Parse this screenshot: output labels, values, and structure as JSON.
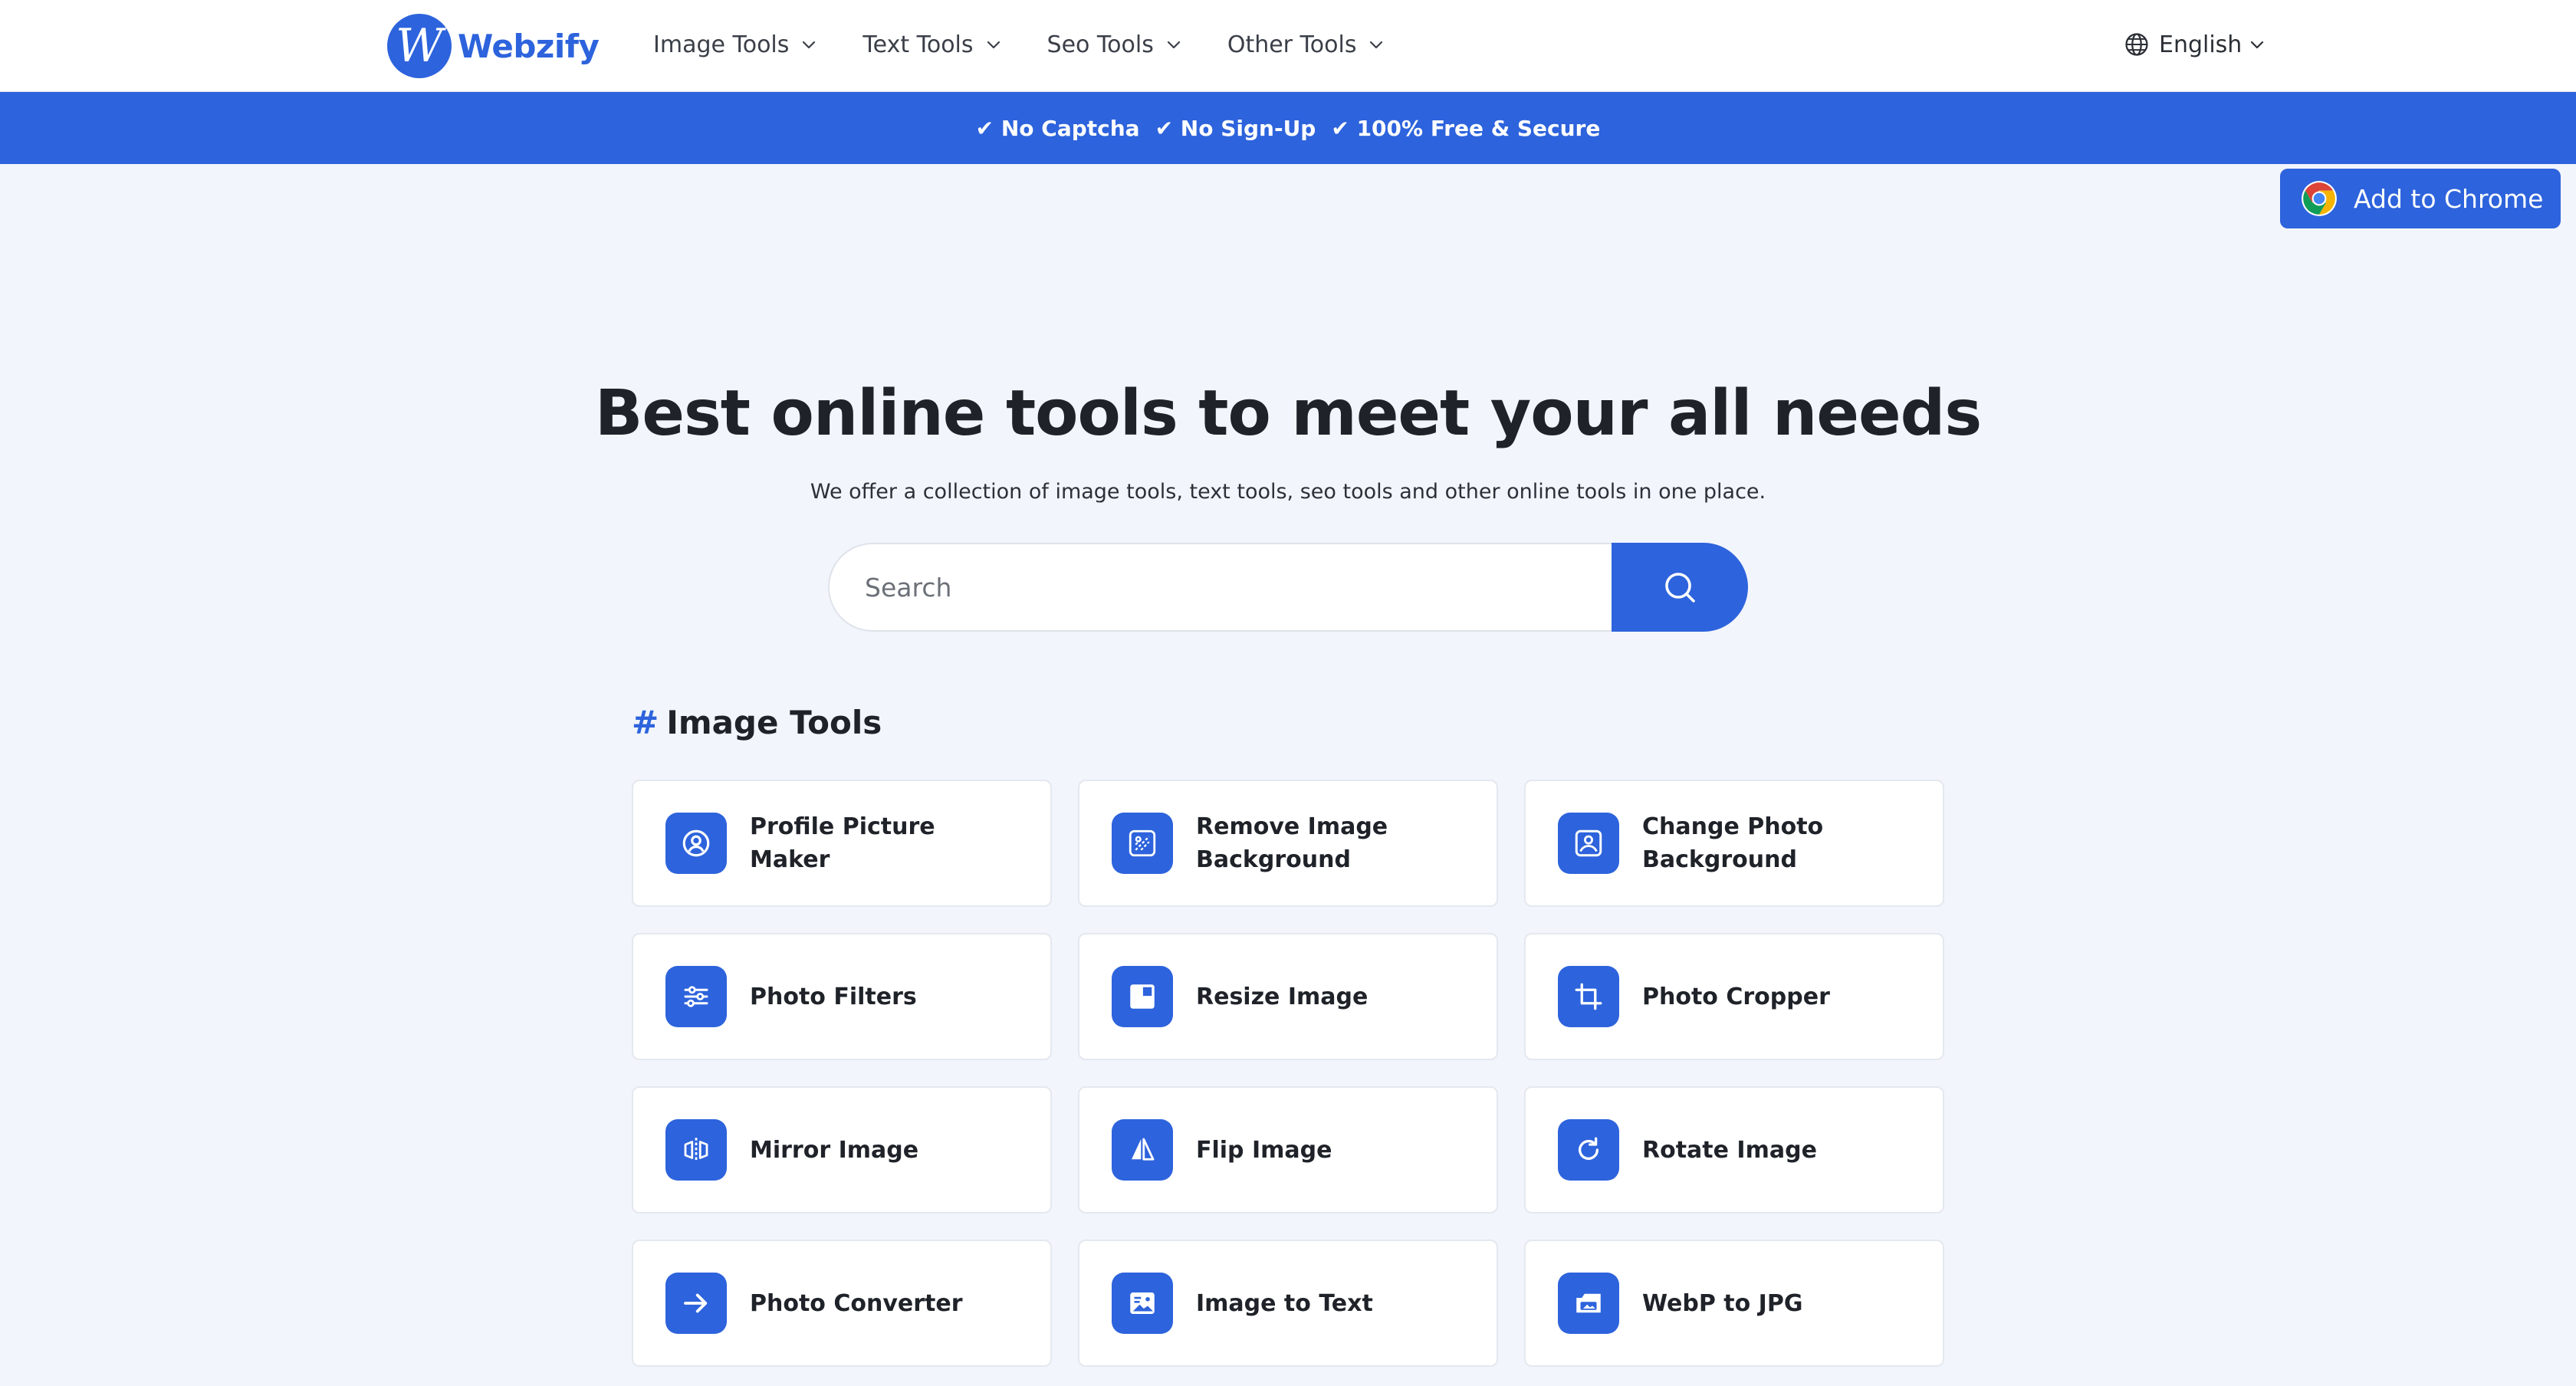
{
  "brand": {
    "logo_letter": "W",
    "name": "Webzify"
  },
  "nav": [
    {
      "label": "Image Tools"
    },
    {
      "label": "Text Tools"
    },
    {
      "label": "Seo Tools"
    },
    {
      "label": "Other Tools"
    }
  ],
  "language": {
    "label": "English",
    "icon": "globe-icon"
  },
  "banner": {
    "items": [
      "✔ No Captcha",
      "✔ No Sign-Up",
      "✔ 100% Free & Secure"
    ]
  },
  "chrome_button": {
    "label": "Add to Chrome",
    "icon": "chrome-icon"
  },
  "hero": {
    "title": "Best online tools to meet your all needs",
    "subtitle": "We offer a collection of image tools, text tools, seo tools and other online tools in one place."
  },
  "search": {
    "placeholder": "Search",
    "value": "",
    "icon": "search-icon"
  },
  "section": {
    "hash": "#",
    "title": "Image Tools"
  },
  "tools": [
    {
      "label": "Profile Picture Maker",
      "icon": "profile-icon"
    },
    {
      "label": "Remove Image Background",
      "icon": "remove-background-icon"
    },
    {
      "label": "Change Photo Background",
      "icon": "change-background-icon"
    },
    {
      "label": "Photo Filters",
      "icon": "sliders-icon"
    },
    {
      "label": "Resize Image",
      "icon": "resize-icon"
    },
    {
      "label": "Photo Cropper",
      "icon": "crop-icon"
    },
    {
      "label": "Mirror Image",
      "icon": "mirror-icon"
    },
    {
      "label": "Flip Image",
      "icon": "flip-icon"
    },
    {
      "label": "Rotate Image",
      "icon": "rotate-icon"
    },
    {
      "label": "Photo Converter",
      "icon": "arrow-right-icon"
    },
    {
      "label": "Image to Text",
      "icon": "image-text-icon"
    },
    {
      "label": "WebP to JPG",
      "icon": "webp-jpg-icon"
    }
  ],
  "colors": {
    "primary": "#2d63dc",
    "background": "#f2f5fb",
    "card": "#ffffff",
    "text": "#1f2329"
  }
}
